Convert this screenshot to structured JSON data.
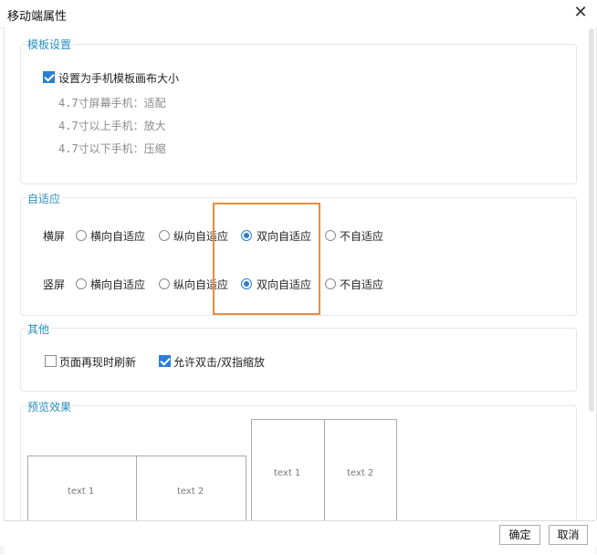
{
  "window": {
    "title": "移动端属性",
    "close_glyph": "✕"
  },
  "template_settings": {
    "title": "模板设置",
    "set_as_canvas_label": "设置为手机模板画布大小",
    "set_as_canvas_checked": true,
    "hints": [
      "4.7寸屏幕手机：适配",
      "4.7寸以上手机：放大",
      "4.7寸以下手机：压缩"
    ]
  },
  "adaptive": {
    "title": "自适应",
    "options": [
      "横向自适应",
      "纵向自适应",
      "双向自适应",
      "不自适应"
    ],
    "landscape": {
      "label": "横屏",
      "selected": "双向自适应"
    },
    "portrait": {
      "label": "竖屏",
      "selected": "双向自适应"
    }
  },
  "other": {
    "title": "其他",
    "refresh_label": "页面再现时刷新",
    "refresh_checked": false,
    "zoom_label": "允许双击/双指缩放",
    "zoom_checked": true
  },
  "preview": {
    "title": "预览效果",
    "landscape_cells": [
      "text 1",
      "text 2"
    ],
    "portrait_cells": [
      "text 1",
      "text 2"
    ]
  },
  "footer": {
    "ok_label": "确定",
    "cancel_label": "取消"
  },
  "colors": {
    "accent": "#2a7fd4",
    "section_title": "#2a8fbd",
    "highlight": "#ef8b3a"
  }
}
